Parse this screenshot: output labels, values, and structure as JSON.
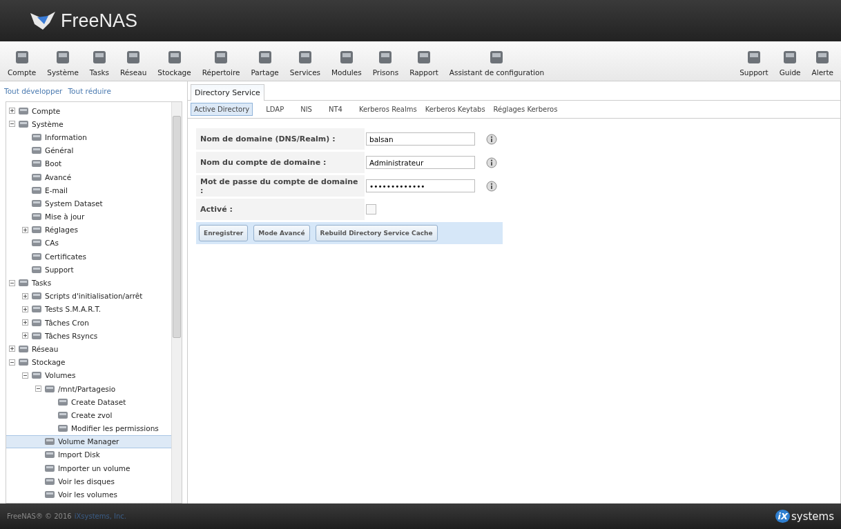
{
  "header": {
    "logo_text": "FreeNAS"
  },
  "toolbar": {
    "left": [
      {
        "label": "Compte"
      },
      {
        "label": "Système"
      },
      {
        "label": "Tasks"
      },
      {
        "label": "Réseau"
      },
      {
        "label": "Stockage"
      },
      {
        "label": "Répertoire"
      },
      {
        "label": "Partage"
      },
      {
        "label": "Services"
      },
      {
        "label": "Modules"
      },
      {
        "label": "Prisons"
      },
      {
        "label": "Rapport"
      },
      {
        "label": "Assistant de configuration"
      }
    ],
    "right": [
      {
        "label": "Support"
      },
      {
        "label": "Guide"
      },
      {
        "label": "Alerte"
      }
    ]
  },
  "sidebar": {
    "links": [
      "Tout développer",
      "Tout réduire"
    ],
    "tree": [
      {
        "label": "Compte",
        "expanded": false,
        "selected": false
      },
      {
        "label": "Système",
        "expanded": true,
        "selected": false,
        "children": [
          {
            "label": "Information",
            "selected": false
          },
          {
            "label": "Général",
            "selected": false
          },
          {
            "label": "Boot",
            "selected": false
          },
          {
            "label": "Avancé",
            "selected": false
          },
          {
            "label": "E-mail",
            "selected": false
          },
          {
            "label": "System Dataset",
            "selected": false
          },
          {
            "label": "Mise à jour",
            "selected": false
          },
          {
            "label": "Réglages",
            "expanded": false,
            "selected": false
          },
          {
            "label": "CAs",
            "selected": false
          },
          {
            "label": "Certificates",
            "selected": false
          },
          {
            "label": "Support",
            "selected": false
          }
        ]
      },
      {
        "label": "Tasks",
        "expanded": true,
        "selected": false,
        "children": [
          {
            "label": "Scripts d'initialisation/arrêt",
            "expanded": false,
            "selected": false
          },
          {
            "label": "Tests S.M.A.R.T.",
            "expanded": false,
            "selected": false
          },
          {
            "label": "Tâches Cron",
            "expanded": false,
            "selected": false
          },
          {
            "label": "Tâches Rsyncs",
            "expanded": false,
            "selected": false
          }
        ]
      },
      {
        "label": "Réseau",
        "expanded": false,
        "selected": false
      },
      {
        "label": "Stockage",
        "expanded": true,
        "selected": false,
        "children": [
          {
            "label": "Volumes",
            "expanded": true,
            "selected": false,
            "children": [
              {
                "label": "/mnt/Partagesio",
                "expanded": true,
                "selected": false,
                "children": [
                  {
                    "label": "Create Dataset",
                    "selected": false
                  },
                  {
                    "label": "Create zvol",
                    "selected": false
                  },
                  {
                    "label": "Modifier les permissions",
                    "selected": false
                  }
                ]
              },
              {
                "label": "Volume Manager",
                "selected": true
              },
              {
                "label": "Import Disk",
                "selected": false
              },
              {
                "label": "Importer un volume",
                "selected": false
              },
              {
                "label": "Voir les disques",
                "selected": false
              },
              {
                "label": "Voir les volumes",
                "selected": false
              }
            ]
          }
        ]
      }
    ]
  },
  "tabs": [
    {
      "label": "Directory Service",
      "selected": true
    }
  ],
  "subtabs": [
    {
      "label": "Active Directory",
      "selected": true
    },
    {
      "label": "LDAP",
      "selected": false
    },
    {
      "label": "NIS",
      "selected": false
    },
    {
      "label": "NT4",
      "selected": false
    },
    {
      "label": "Kerberos Realms",
      "selected": false
    },
    {
      "label": "Kerberos Keytabs",
      "selected": false
    },
    {
      "label": "Réglages Kerberos",
      "selected": false
    }
  ],
  "form": {
    "fields": [
      {
        "label": "Nom de domaine (DNS/Realm) :",
        "kind": "text",
        "value": "balsan"
      },
      {
        "label": "Nom du compte de domaine :",
        "kind": "text",
        "value": "Administrateur"
      },
      {
        "label": "Mot de passe du compte de domaine :",
        "kind": "text",
        "value": "•••••••••••••"
      },
      {
        "label": "Activé :",
        "kind": "checkbox",
        "checked": false
      }
    ],
    "buttons": [
      "Enregistrer",
      "Mode Avancé",
      "Rebuild Directory Service Cache"
    ]
  },
  "footer": {
    "copyright": "FreeNAS® © 2016",
    "company": "iXsystems, Inc.",
    "logo_mark": "iX",
    "logo_text": "systems"
  }
}
